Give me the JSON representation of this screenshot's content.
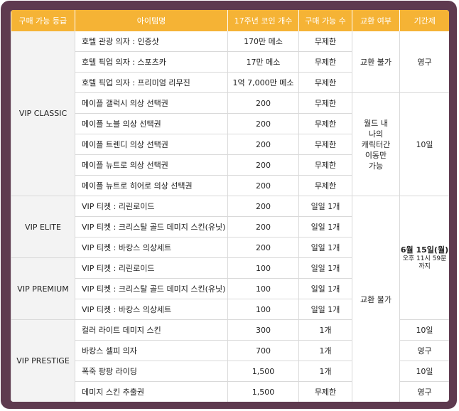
{
  "headers": [
    "구매 가능 등급",
    "아이템명",
    "17주년 코인 개수",
    "구매 가능 수",
    "교환 여부",
    "기간제"
  ],
  "tiers": {
    "classic": "VIP CLASSIC",
    "elite": "VIP ELITE",
    "premium": "VIP PREMIUM",
    "prestige": "VIP PRESTIGE"
  },
  "rows": [
    {
      "item": "호텔 관광 의자 : 인증샷",
      "coins": "170만 메소",
      "limit": "무제한"
    },
    {
      "item": "호텔 픽업 의자 : 스포츠카",
      "coins": "17만 메소",
      "limit": "무제한"
    },
    {
      "item": "호텔 픽업 의자 : 프리미엄 리무진",
      "coins": "1억 7,000만 메소",
      "limit": "무제한"
    },
    {
      "item": "메이플 갤럭시 의상 선택권",
      "coins": "200",
      "limit": "무제한"
    },
    {
      "item": "메이플 노블 의상 선택권",
      "coins": "200",
      "limit": "무제한"
    },
    {
      "item": "메이플 트렌디 의상 선택권",
      "coins": "200",
      "limit": "무제한"
    },
    {
      "item": "메이플 뉴트로 의상 선택권",
      "coins": "200",
      "limit": "무제한"
    },
    {
      "item": "메이플 뉴트로 히어로 의상 선택권",
      "coins": "200",
      "limit": "무제한"
    },
    {
      "item": "VIP 티켓 : 리린로이드",
      "coins": "200",
      "limit": "일일 1개"
    },
    {
      "item": "VIP 티켓 : 크리스탈 골드 데미지 스킨(유닛)",
      "coins": "200",
      "limit": "일일 1개"
    },
    {
      "item": "VIP 티켓 : 바캉스 의상세트",
      "coins": "200",
      "limit": "일일 1개"
    },
    {
      "item": "VIP 티켓 : 리린로이드",
      "coins": "100",
      "limit": "일일 1개"
    },
    {
      "item": "VIP 티켓 : 크리스탈 골드 데미지 스킨(유닛)",
      "coins": "100",
      "limit": "일일 1개"
    },
    {
      "item": "VIP 티켓 : 바캉스 의상세트",
      "coins": "100",
      "limit": "일일 1개"
    },
    {
      "item": "컬러 라이트 데미지 스킨",
      "coins": "300",
      "limit": "1개"
    },
    {
      "item": "바캉스 셀피 의자",
      "coins": "700",
      "limit": "1개"
    },
    {
      "item": "폭죽 팡팡 라이딩",
      "coins": "1,500",
      "limit": "1개"
    },
    {
      "item": "데미지 스킨 추출권",
      "coins": "1,500",
      "limit": "무제한"
    }
  ],
  "exchange": {
    "no_exchange_top": "교환 불가",
    "world_only": [
      "월드 내",
      "나의",
      "캐릭터간",
      "이동만",
      "가능"
    ],
    "no_exchange_bottom": "교환 불가"
  },
  "period": {
    "permanent_top": "영구",
    "ten_days_classic": "10일",
    "june_date": "6월 15일(월)",
    "june_time": "오후 11시 59분",
    "june_until": "까지",
    "p_row15": "10일",
    "p_row16": "영구",
    "p_row17": "10일",
    "p_row18": "영구"
  }
}
